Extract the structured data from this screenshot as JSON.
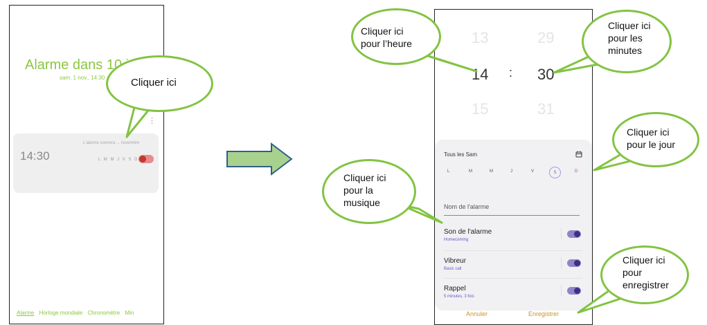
{
  "left_phone": {
    "title": "Alarme dans 10 je",
    "subtitle": "sam. 1 nov., 14:30",
    "alarm": {
      "time": "14:30",
      "note": "L'alarme sonnera ... novembre",
      "days": "L M M J V S D"
    },
    "tabs": [
      "Alarme",
      "Horloge mondiale",
      "Chronomètre",
      "Min"
    ]
  },
  "right_phone": {
    "hours": [
      "13",
      "14",
      "15"
    ],
    "separator": ":",
    "minutes": [
      "29",
      "30",
      "31"
    ],
    "repeat_label": "Tous les Sam",
    "days": [
      "L",
      "M",
      "M",
      "J",
      "V",
      "S",
      "D"
    ],
    "alarm_name_placeholder": "Nom de l'alarme",
    "settings": [
      {
        "label": "Son de l'alarme",
        "value": "Homecoming"
      },
      {
        "label": "Vibreur",
        "value": "Basic call"
      },
      {
        "label": "Rappel",
        "value": "5 minutes, 3 fois"
      }
    ],
    "cancel_label": "Annuler",
    "save_label": "Enregistrer"
  },
  "callouts": {
    "left": "Cliquer ici",
    "hour": [
      "Cliquer ici",
      "pour l’heure"
    ],
    "minutes": [
      "Cliquer ici",
      "pour les",
      "minutes"
    ],
    "day": [
      "Cliquer ici",
      "pour le jour"
    ],
    "music": [
      "Cliquer ici",
      "pour la",
      "musique"
    ],
    "save": [
      "Cliquer ici",
      "pour",
      "enregistrer"
    ]
  },
  "colors": {
    "green_accent": "#8cc63f",
    "bubble_border": "#82c341",
    "purple": "#6a57c8",
    "gold": "#c9962b",
    "sunday_red": "#e0404a",
    "arrow_fill": "#a9d18e",
    "arrow_stroke": "#2f5f8a"
  },
  "icons": {
    "calendar": "calendar-icon",
    "more": "more-vert-icon",
    "arrow": "right-arrow-icon"
  }
}
